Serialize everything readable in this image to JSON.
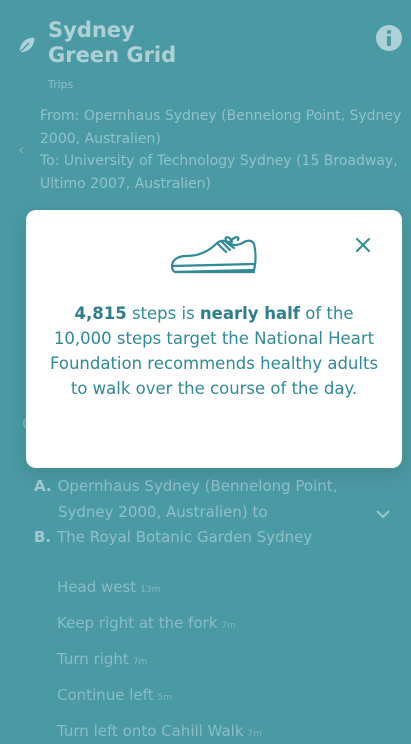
{
  "app": {
    "brand_line1": "Sydney",
    "brand_line2": "Green Grid",
    "brand_sub": "Trips"
  },
  "route": {
    "from": "From: Opernhaus Sydney (Bennelong Point, Sydney 2000, Australien)",
    "to": "To: University of Technology Sydney (15 Broadway, Ultimo 2007, Australien)"
  },
  "directions": {
    "a_letter": "A.",
    "a_text": "Opernhaus Sydney (Bennelong Point,",
    "a_text_cont": "Sydney 2000, Australien) to",
    "b_letter": "B.",
    "b_text": "The Royal Botanic Garden Sydney"
  },
  "steps": [
    {
      "text": "Head west",
      "dist": "13m"
    },
    {
      "text": "Keep right at the fork",
      "dist": "7m"
    },
    {
      "text": "Turn right",
      "dist": "7m"
    },
    {
      "text": "Continue left",
      "dist": "5m"
    },
    {
      "text": "Turn left onto Cahill Walk",
      "dist": "7m"
    }
  ],
  "modal": {
    "steps_count": "4,815",
    "text_1": " steps is ",
    "emphasis": "nearly half",
    "text_2": " of the 10,000 steps target the National Heart Foundation recommends healthy adults to walk over the course of the day.",
    "icon": "sneaker-icon"
  },
  "colors": {
    "background": "#4a9aa3",
    "modal_text": "#2f8a96",
    "modal_bg": "#ffffff"
  }
}
